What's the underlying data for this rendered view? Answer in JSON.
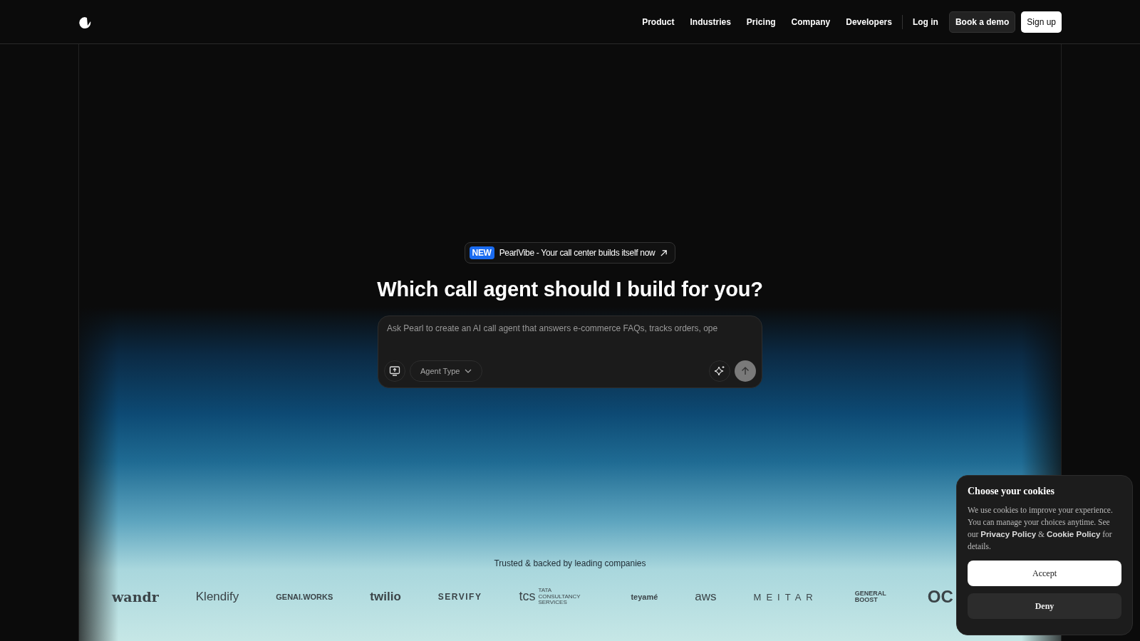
{
  "nav": {
    "links": [
      "Product",
      "Industries",
      "Pricing",
      "Company",
      "Developers"
    ],
    "login": "Log in",
    "demo": "Book a demo",
    "signup": "Sign up"
  },
  "badge": {
    "tag": "NEW",
    "text": "PearlVibe - Your call center builds itself now"
  },
  "heading": "Which call agent should I build for you?",
  "prompt": {
    "placeholder": "Ask Pearl to create an AI call agent that answers e-commerce FAQs, tracks orders, ope",
    "agent_type": "Agent Type"
  },
  "trusted": "Trusted & backed by leading companies",
  "logos": [
    {
      "name": "wandr",
      "kind": "serif"
    },
    {
      "name": "Klendify",
      "kind": "plain"
    },
    {
      "name": "GENAI.WORKS",
      "kind": "small"
    },
    {
      "name": "twilio",
      "kind": "bold"
    },
    {
      "name": "SERVIFY",
      "kind": "spaced"
    },
    {
      "name": "tcs",
      "kind": "thin",
      "sub": "TATA CONSULTANCY SERVICES"
    },
    {
      "name": "teyamé",
      "kind": "small"
    },
    {
      "name": "aws",
      "kind": "plain"
    },
    {
      "name": "MEITAR",
      "kind": "wide"
    },
    {
      "name": "GENERAL BOOST",
      "kind": "stack"
    },
    {
      "name": "OC",
      "kind": "big"
    }
  ],
  "cookies": {
    "title": "Choose your cookies",
    "parts": [
      {
        "text": "We use cookies to improve your experience. You can manage your choices anytime. See our ",
        "kind": "text"
      },
      {
        "text": "Privacy Policy",
        "kind": "link"
      },
      {
        "text": " & ",
        "kind": "text"
      },
      {
        "text": "Cookie Policy",
        "kind": "link"
      },
      {
        "text": " for details.",
        "kind": "text"
      }
    ],
    "accept": "Accept",
    "deny": "Deny"
  }
}
